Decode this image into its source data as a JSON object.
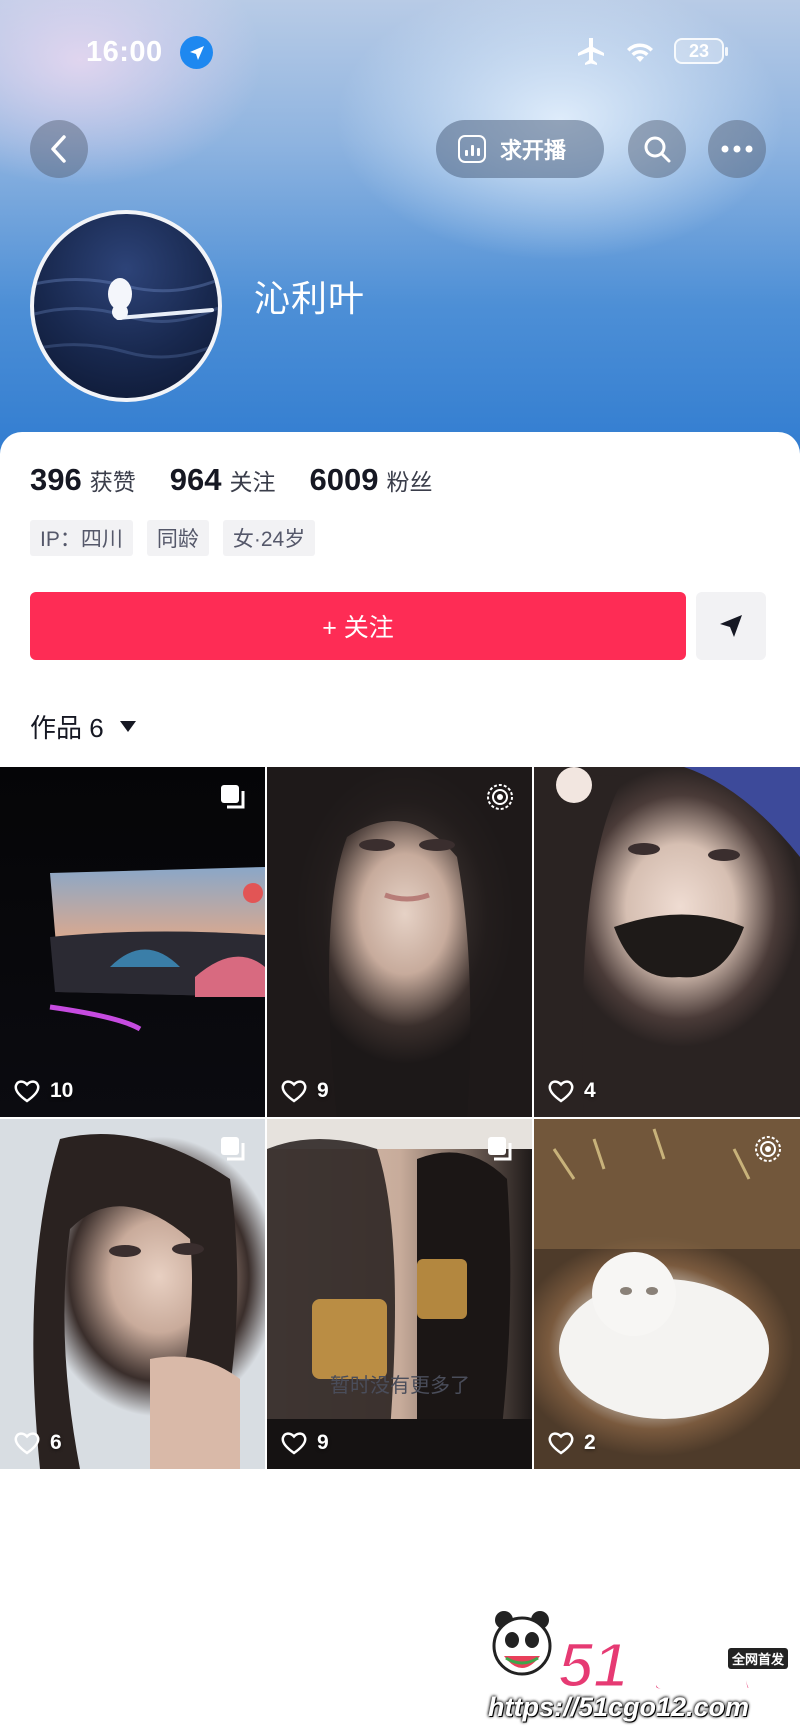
{
  "status_bar": {
    "time": "16:00",
    "battery": "23"
  },
  "nav": {
    "pill_label": "求开播"
  },
  "profile": {
    "username": "沁利叶"
  },
  "stats": [
    {
      "num": "396",
      "label": "获赞"
    },
    {
      "num": "964",
      "label": "关注"
    },
    {
      "num": "6009",
      "label": "粉丝"
    }
  ],
  "tags": [
    "IP：四川",
    "同龄",
    "女·24岁"
  ],
  "follow_label": "+ 关注",
  "works": {
    "title": "作品 6"
  },
  "videos": [
    {
      "likes": "10",
      "type": "images"
    },
    {
      "likes": "9",
      "type": "live-photo"
    },
    {
      "likes": "4",
      "type": "video"
    },
    {
      "likes": "6",
      "type": "images"
    },
    {
      "likes": "9",
      "type": "images"
    },
    {
      "likes": "2",
      "type": "live-photo"
    }
  ],
  "footer_text": "暂时没有更多了",
  "watermark": {
    "logo": "51吃瓜",
    "sub": "全网首发",
    "url": "https://51cgo12.com"
  },
  "colors": {
    "accent": "#fe2c55",
    "header": "#2f7bd0"
  }
}
